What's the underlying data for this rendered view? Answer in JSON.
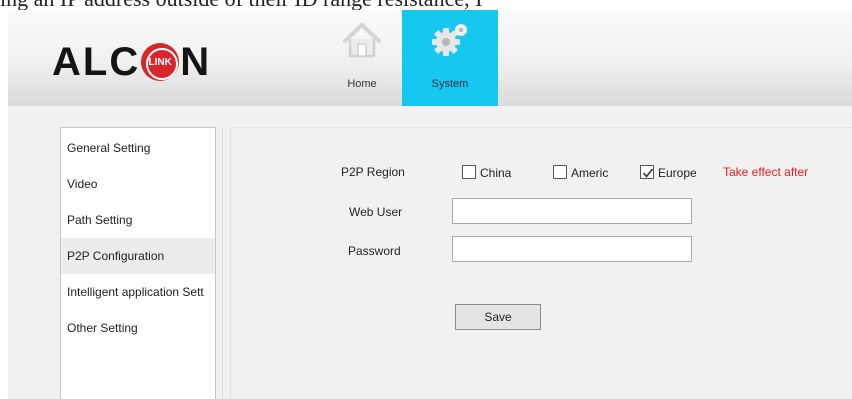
{
  "top_strip_text": "ing an IP address outside of their ID range resistance, I",
  "brand": {
    "name_left": "ALC",
    "badge": "LINK",
    "name_right": "N"
  },
  "nav": {
    "tabs": [
      {
        "label": "Home",
        "icon": "house-icon",
        "active": false
      },
      {
        "label": "System",
        "icon": "gear-icon",
        "active": true
      }
    ],
    "active_color": "#16c8f0"
  },
  "sidebar": {
    "items": [
      {
        "label": "General Setting",
        "active": false
      },
      {
        "label": "Video",
        "active": false
      },
      {
        "label": "Path Setting",
        "active": false
      },
      {
        "label": "P2P Configuration",
        "active": true
      },
      {
        "label": "Intelligent application Sett",
        "active": false
      },
      {
        "label": "Other Setting",
        "active": false
      }
    ]
  },
  "form": {
    "p2p_region_label": "P2P Region",
    "regions": [
      {
        "label": "China",
        "checked": false
      },
      {
        "label": "Americ",
        "checked": false
      },
      {
        "label": "Europe",
        "checked": true
      }
    ],
    "note": "Take effect after",
    "note_color": "#e52020",
    "web_user_label": "Web User",
    "web_user_value": "",
    "password_label": "Password",
    "password_value": "",
    "save_label": "Save"
  }
}
